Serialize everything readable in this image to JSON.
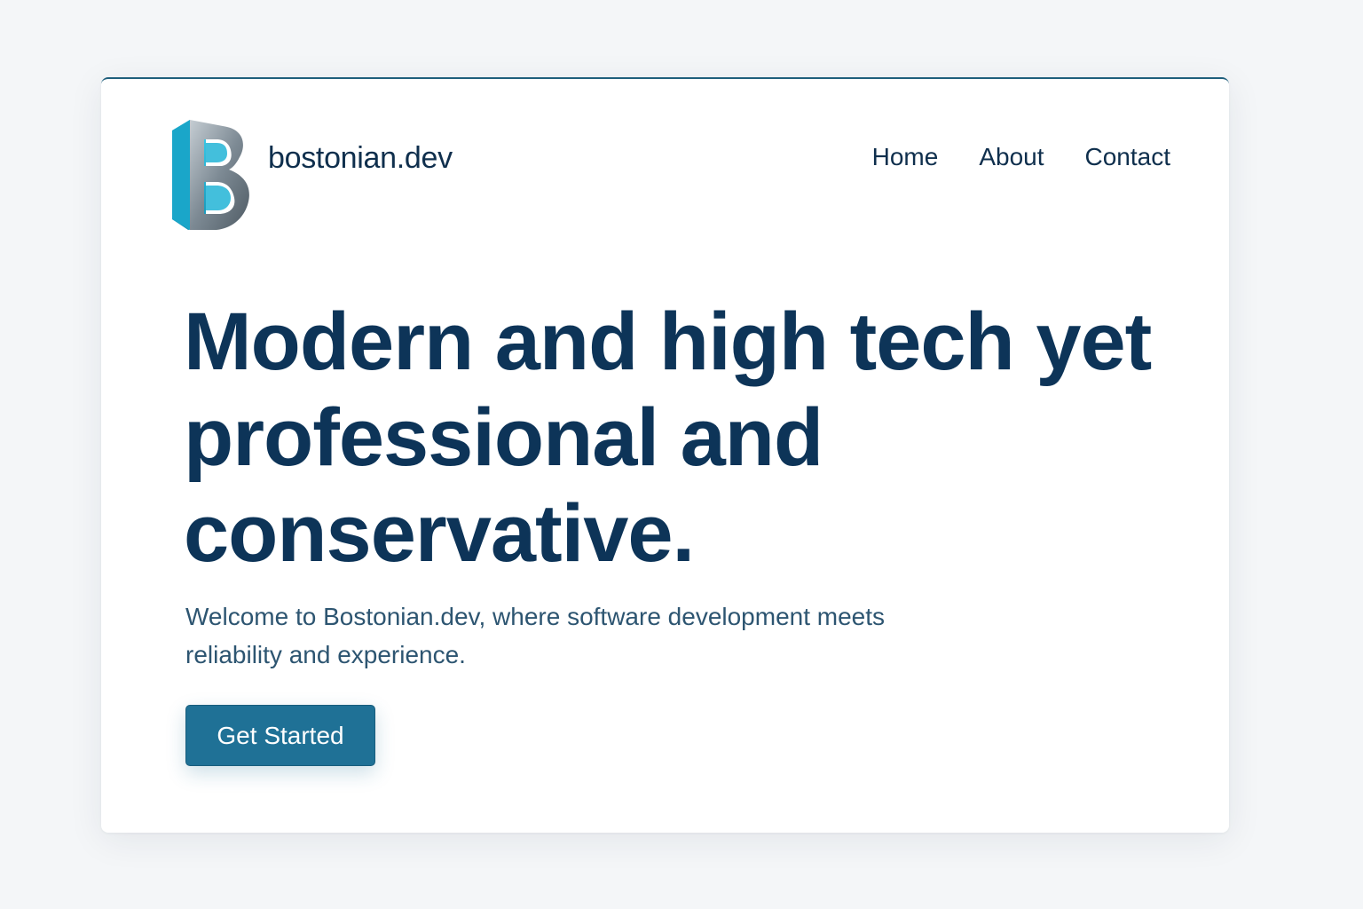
{
  "brand": {
    "logo_icon": "b-logo-icon",
    "name": "bostonian.dev"
  },
  "nav": {
    "items": [
      {
        "label": "Home"
      },
      {
        "label": "About"
      },
      {
        "label": "Contact"
      }
    ]
  },
  "hero": {
    "title": "Modern and high tech yet professional and conservative.",
    "subtitle": "Welcome to Bostonian.dev, where software development meets reliability and experience.",
    "cta_label": "Get Started"
  },
  "colors": {
    "page_background": "#f4f6f8",
    "card_background": "#ffffff",
    "heading": "#0d3458",
    "body_text": "#2d5571",
    "accent": "#1f7196",
    "logo_cyan": "#22b4d6"
  }
}
